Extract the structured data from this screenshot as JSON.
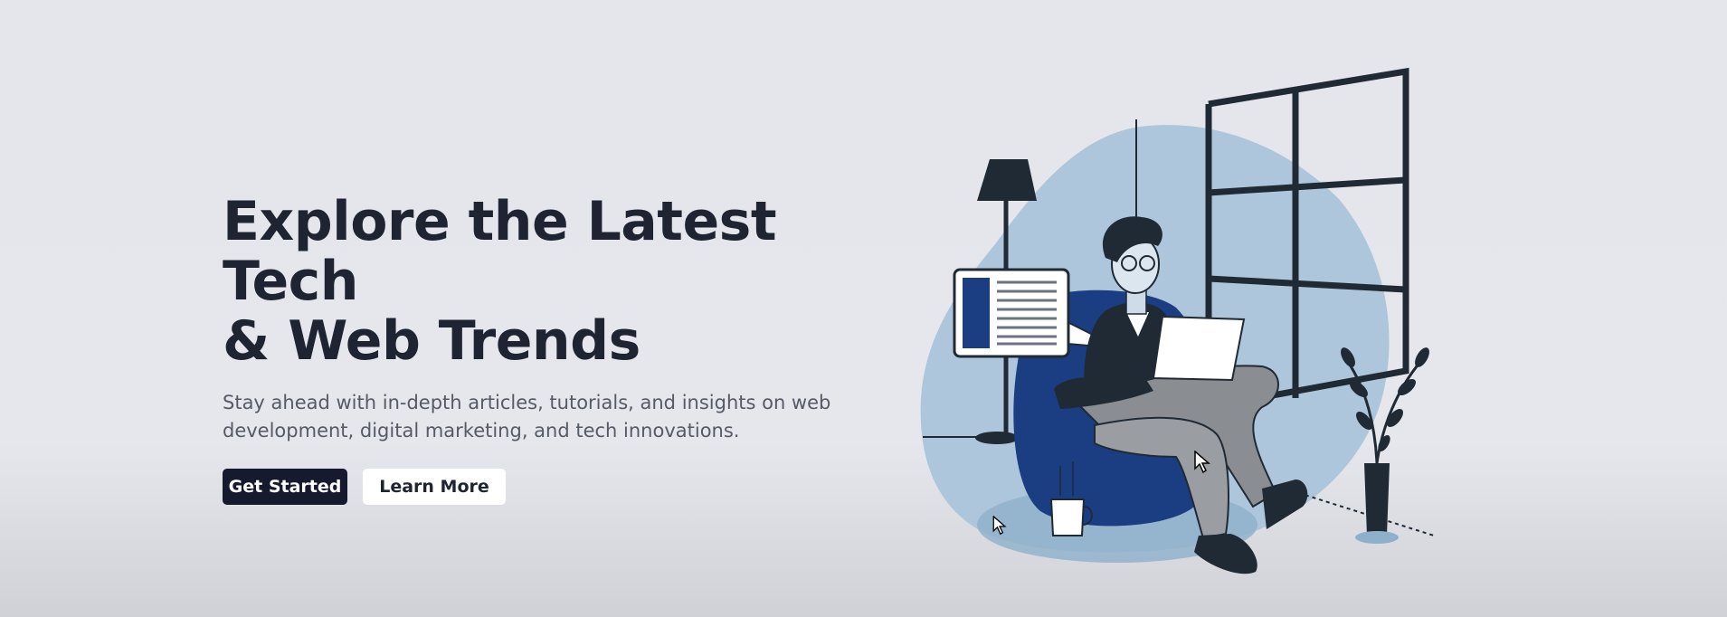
{
  "hero": {
    "headline_line1": "Explore the Latest Tech",
    "headline_line2": "& Web Trends",
    "subtitle_line1": "Stay ahead with in-depth articles, tutorials, and insights on web",
    "subtitle_line2": "development, digital marketing, and tech innovations.",
    "primary_button": "Get Started",
    "secondary_button": "Learn More"
  },
  "colors": {
    "background": "#e4e6ec",
    "headline": "#1f2433",
    "primary_button_bg": "#161a2e",
    "illustration_navy": "#1b3d82",
    "illustration_blob": "#adc6db",
    "illustration_dark": "#1f2a35"
  },
  "illustration": {
    "icon": "person-working-on-laptop-illustration"
  }
}
